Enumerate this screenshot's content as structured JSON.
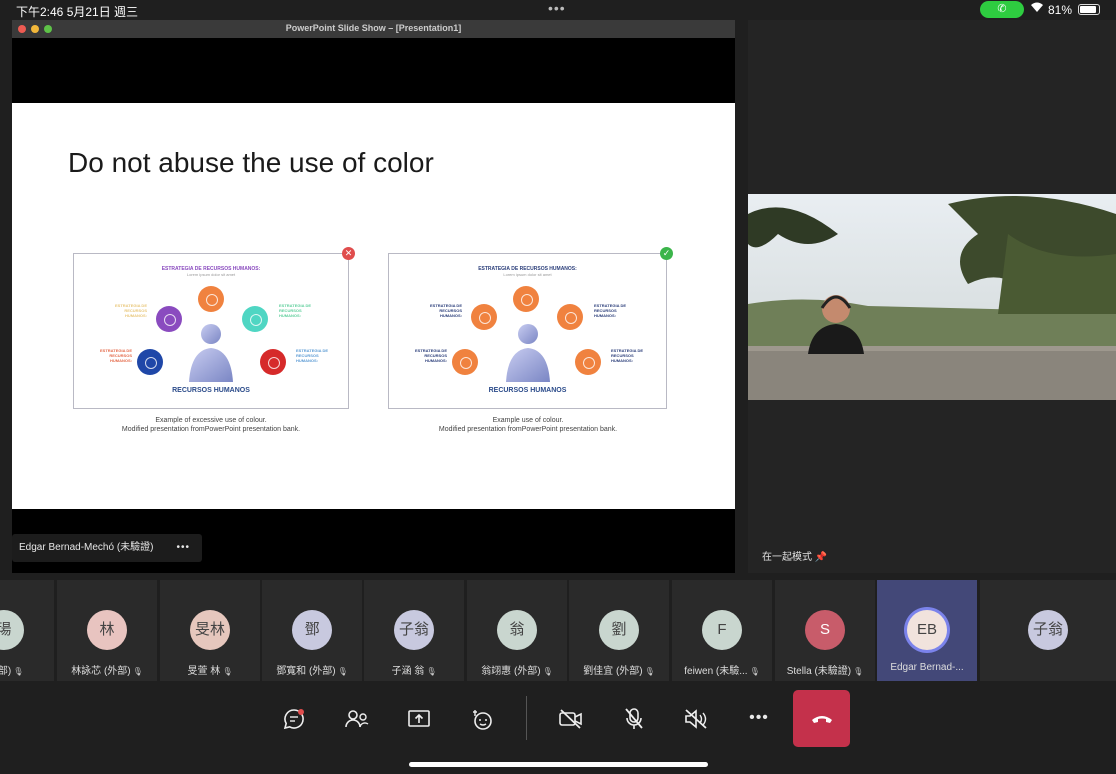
{
  "status_bar": {
    "time": "下午2:46   5月21日 週三",
    "battery": "81%"
  },
  "presentation": {
    "window_title": "PowerPoint Slide Show – [Presentation1]",
    "slide_heading": "Do not abuse the use of color",
    "example_bad": {
      "header": "ESTRATEGIA DE RECURSOS HUMANOS:",
      "sub": "Lorem ipsum dolor sit amet",
      "center_label": "RECURSOS HUMANOS",
      "caption_line1": "Example of excessive use of colour.",
      "caption_line2": "Modified presentation fromPowerPoint presentation bank.",
      "badge": "✕",
      "nodes": [
        {
          "label": "ESTRATEGIA DE RECURSOS HUMANOS:",
          "color": "#f0823f"
        },
        {
          "label": "ESTRATEGIA DE RECURSOS HUMANOS:",
          "color": "#8a4bbf"
        },
        {
          "label": "ESTRATEGIA DE RECURSOS HUMANOS:",
          "color": "#4fd6c3"
        },
        {
          "label": "ESTRATEGIA DE RECURSOS HUMANOS:",
          "color": "#1f47a8"
        },
        {
          "label": "ESTRATEGIA DE RECURSOS HUMANOS:",
          "color": "#d62a2a"
        }
      ]
    },
    "example_good": {
      "header": "ESTRATEGIA DE RECURSOS HUMANOS:",
      "sub": "Lorem ipsum dolor sit amet",
      "center_label": "RECURSOS HUMANOS",
      "caption_line1": "Example use of colour.",
      "caption_line2": "Modified presentation fromPowerPoint presentation bank.",
      "badge": "✓",
      "node_color": "#f0823f"
    },
    "presenter_name": "Edgar Bernad-Mechó (未驗證)",
    "presenter_more": "•••"
  },
  "right_pane": {
    "mode_label": "在一起模式 📌"
  },
  "participants": [
    {
      "initials": "瑒",
      "name": "(外部)",
      "color": "#c9d6cf"
    },
    {
      "initials": "林",
      "name": "林詠芯 (外部)",
      "color": "#e8c4c0"
    },
    {
      "initials": "旻林",
      "name": "旻萱 林",
      "color": "#e6c7bd"
    },
    {
      "initials": "鄧",
      "name": "鄧寬和 (外部)",
      "color": "#c8c9df"
    },
    {
      "initials": "子翁",
      "name": "子涵 翁",
      "color": "#c8c9df"
    },
    {
      "initials": "翁",
      "name": "翁翊惠 (外部)",
      "color": "#c9d6cf"
    },
    {
      "initials": "劉",
      "name": "劉佳宜 (外部)",
      "color": "#c9d6cf"
    },
    {
      "initials": "F",
      "name": "feiwen (未驗...",
      "color": "#c9d6cf"
    },
    {
      "initials": "S",
      "name": "Stella (未驗證)",
      "color": "#c85c6a"
    },
    {
      "initials": "EB",
      "name": "Edgar Bernad-...",
      "color": "#f1e3dd"
    },
    {
      "initials": "子翁",
      "name": "",
      "color": "#c8c9df"
    }
  ],
  "toolbar": {
    "chat_icon": "chat-icon",
    "people_icon": "people-icon",
    "share_icon": "share-icon",
    "reactions_icon": "reactions-icon",
    "video_off_icon": "video-off-icon",
    "mic_off_icon": "mic-off-icon",
    "speaker_off_icon": "speaker-off-icon",
    "more": "•••",
    "leave_color": "#c4314b"
  }
}
